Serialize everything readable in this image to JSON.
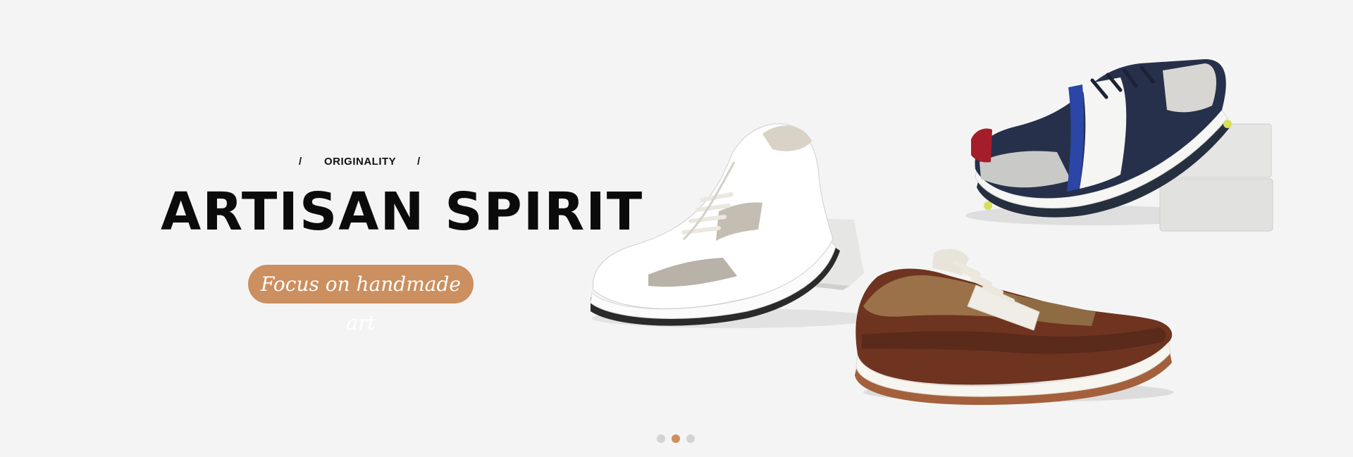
{
  "hero": {
    "eyebrow": {
      "slash_left": "/",
      "text": "ORIGINALITY",
      "slash_right": "/"
    },
    "headline": "ARTISAN SPIRIT",
    "tagline_button": "Focus on handmade art"
  },
  "shoes": [
    {
      "icon": "white-leather-sneaker-image"
    },
    {
      "icon": "navy-white-sneaker-image"
    },
    {
      "icon": "brown-leather-sneaker-image"
    }
  ],
  "carousel": {
    "slide_count": 3,
    "active_index": 1,
    "active_color": "#cc8f5f",
    "inactive_color": "#d3d3d3"
  },
  "colors": {
    "background": "#f4f4f4",
    "accent": "#cc8f5f",
    "headline": "#0b0b0b"
  }
}
